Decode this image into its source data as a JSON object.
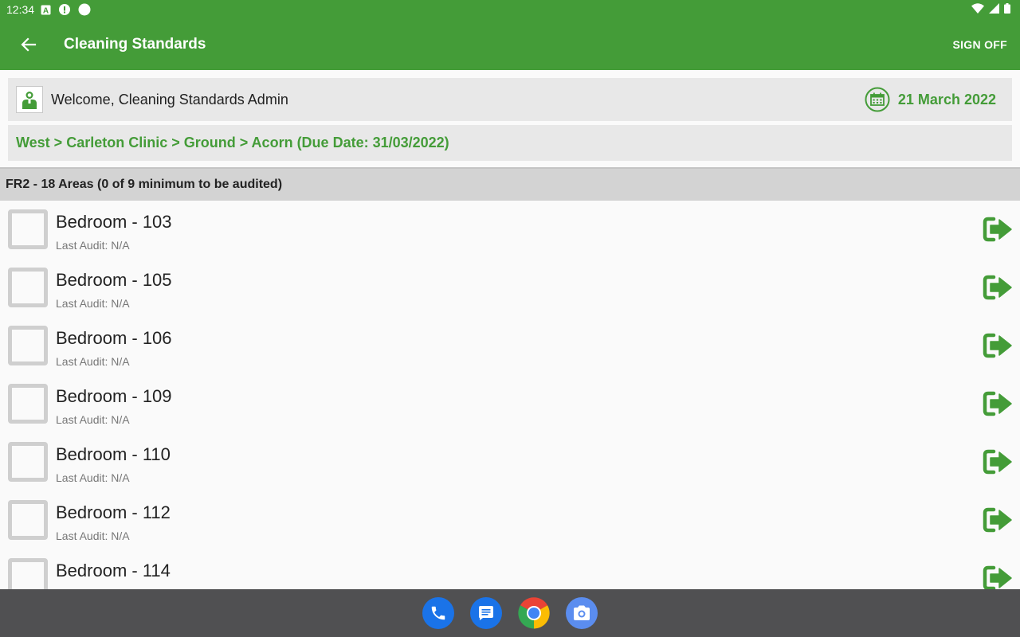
{
  "status_bar": {
    "time": "12:34"
  },
  "app_bar": {
    "title": "Cleaning Standards",
    "sign_off": "SIGN OFF"
  },
  "welcome": {
    "text": "Welcome, Cleaning Standards Admin",
    "date": "21 March 2022"
  },
  "breadcrumb": {
    "text": "West > Carleton Clinic > Ground > Acorn (Due Date: 31/03/2022)"
  },
  "section": {
    "header": "FR2 - 18 Areas (0 of 9 minimum to be audited)"
  },
  "areas": [
    {
      "title": "Bedroom - 103",
      "sub": "Last Audit: N/A"
    },
    {
      "title": "Bedroom - 105",
      "sub": "Last Audit: N/A"
    },
    {
      "title": "Bedroom - 106",
      "sub": "Last Audit: N/A"
    },
    {
      "title": "Bedroom - 109",
      "sub": "Last Audit: N/A"
    },
    {
      "title": "Bedroom - 110",
      "sub": "Last Audit: N/A"
    },
    {
      "title": "Bedroom - 112",
      "sub": "Last Audit: N/A"
    },
    {
      "title": "Bedroom - 114",
      "sub": ""
    }
  ],
  "icons": {
    "back": "arrow-left-icon",
    "avatar": "cleaner-avatar-icon",
    "calendar": "calendar-icon",
    "open_area": "sign-in-arrow-icon",
    "dock": [
      "phone-icon",
      "messages-icon",
      "chrome-icon",
      "camera-icon"
    ]
  },
  "colors": {
    "primary": "#449c38",
    "panel": "#e8e8e8",
    "section": "#d3d3d3",
    "nav": "#505052"
  }
}
